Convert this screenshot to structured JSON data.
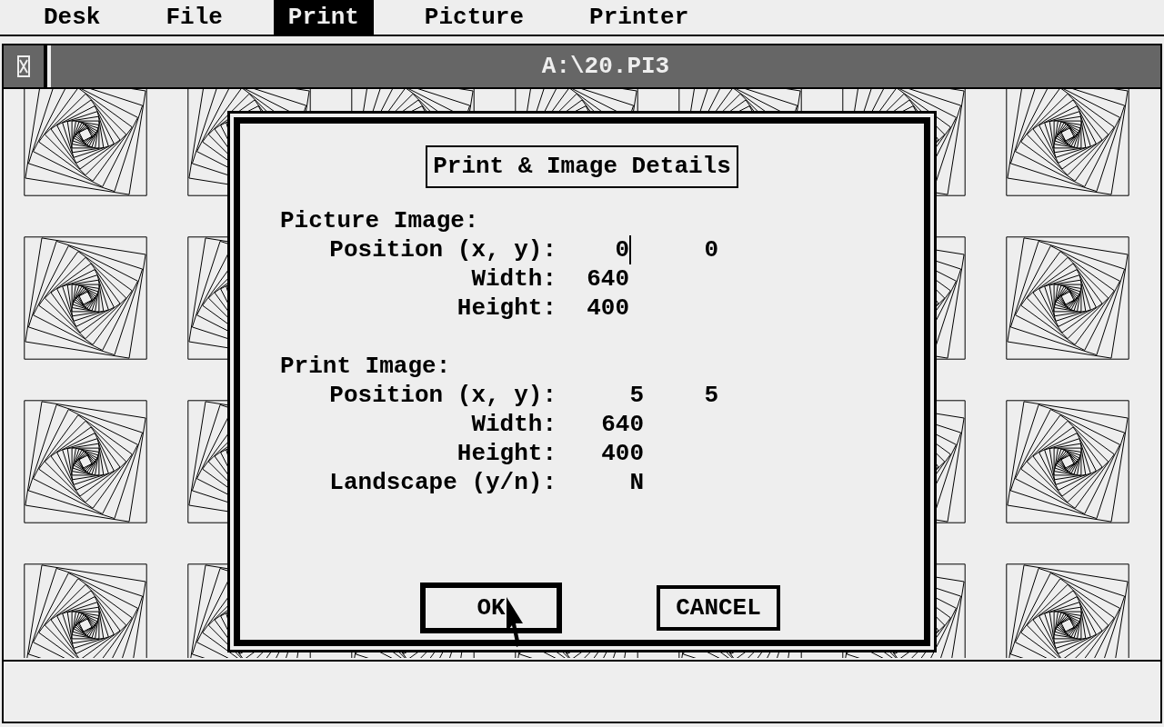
{
  "menu_bar": [
    {
      "label": "Desk",
      "selected": false
    },
    {
      "label": "File",
      "selected": false
    },
    {
      "label": "Print",
      "selected": true
    },
    {
      "label": "Picture",
      "selected": false
    },
    {
      "label": "Printer",
      "selected": false
    }
  ],
  "window": {
    "title": "A:\\20.PI3"
  },
  "dialog": {
    "title": "Print & Image Details",
    "sections": [
      {
        "heading": "Picture Image:",
        "rows": [
          {
            "label": "Position (x, y):",
            "values": [
              "0",
              "0"
            ],
            "cursor": true
          },
          {
            "label": "Width:",
            "values": [
              "640"
            ],
            "cursor": false
          },
          {
            "label": "Height:",
            "values": [
              "400"
            ],
            "cursor": false
          }
        ]
      },
      {
        "heading": "Print Image:",
        "rows": [
          {
            "label": "Position (x, y):",
            "values": [
              "5",
              "5"
            ],
            "cursor": false
          },
          {
            "label": "Width:",
            "values": [
              "640"
            ],
            "cursor": false
          },
          {
            "label": "Height:",
            "values": [
              "400"
            ],
            "cursor": false
          },
          {
            "label": "Landscape (y/n):",
            "values": [
              "N"
            ],
            "cursor": false
          }
        ]
      }
    ],
    "buttons": [
      {
        "label": "OK",
        "default": true
      },
      {
        "label": "CANCEL",
        "default": false
      }
    ]
  }
}
